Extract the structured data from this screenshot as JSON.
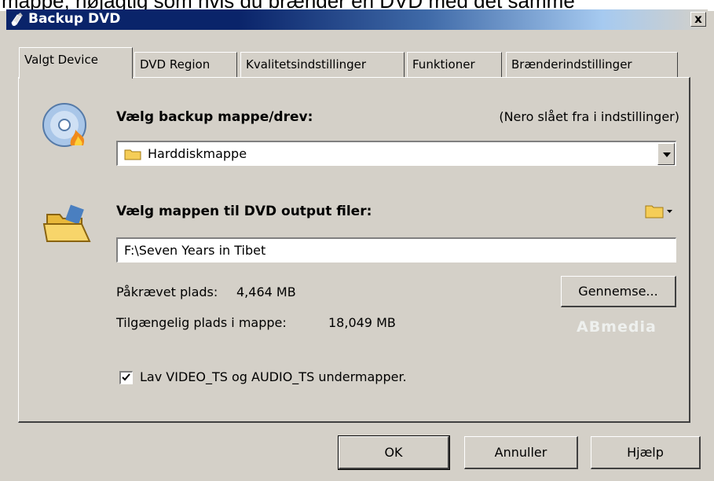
{
  "caption_text": "mappe, nøjagtig som hvis du brænder en DVD med det samme",
  "window": {
    "title": "Backup DVD",
    "close_label": "x"
  },
  "tabs": [
    {
      "label": "Valgt Device",
      "active": true
    },
    {
      "label": "DVD Region"
    },
    {
      "label": "Kvalitetsindstillinger"
    },
    {
      "label": "Funktioner"
    },
    {
      "label": "Brænderindstillinger"
    }
  ],
  "backup_section": {
    "label": "Vælg backup mappe/drev:",
    "note": "(Nero slået fra i indstillinger)",
    "selected": "Harddiskmappe"
  },
  "output_section": {
    "label": "Vælg mappen til DVD output filer:",
    "path_value": "F:\\Seven Years in Tibet"
  },
  "space": {
    "required_label": "Påkrævet plads:",
    "required_value": "4,464 MB",
    "available_label": "Tilgængelig plads i mappe:",
    "available_value": "18,049 MB"
  },
  "browse_label": "Gennemse...",
  "watermark": "ABmedia",
  "checkbox": {
    "label": "Lav VIDEO_TS og AUDIO_TS undermapper.",
    "checked": true
  },
  "buttons": {
    "ok": "OK",
    "cancel": "Annuller",
    "help": "Hjælp"
  },
  "colors": {
    "titlebar_start": "#0a246a",
    "window_bg": "#d4d0c8"
  },
  "icons": [
    "app-icon",
    "disc-burn-icon",
    "folder-icon",
    "folder-open-icon",
    "folder-menu-icon",
    "checkmark-icon"
  ]
}
